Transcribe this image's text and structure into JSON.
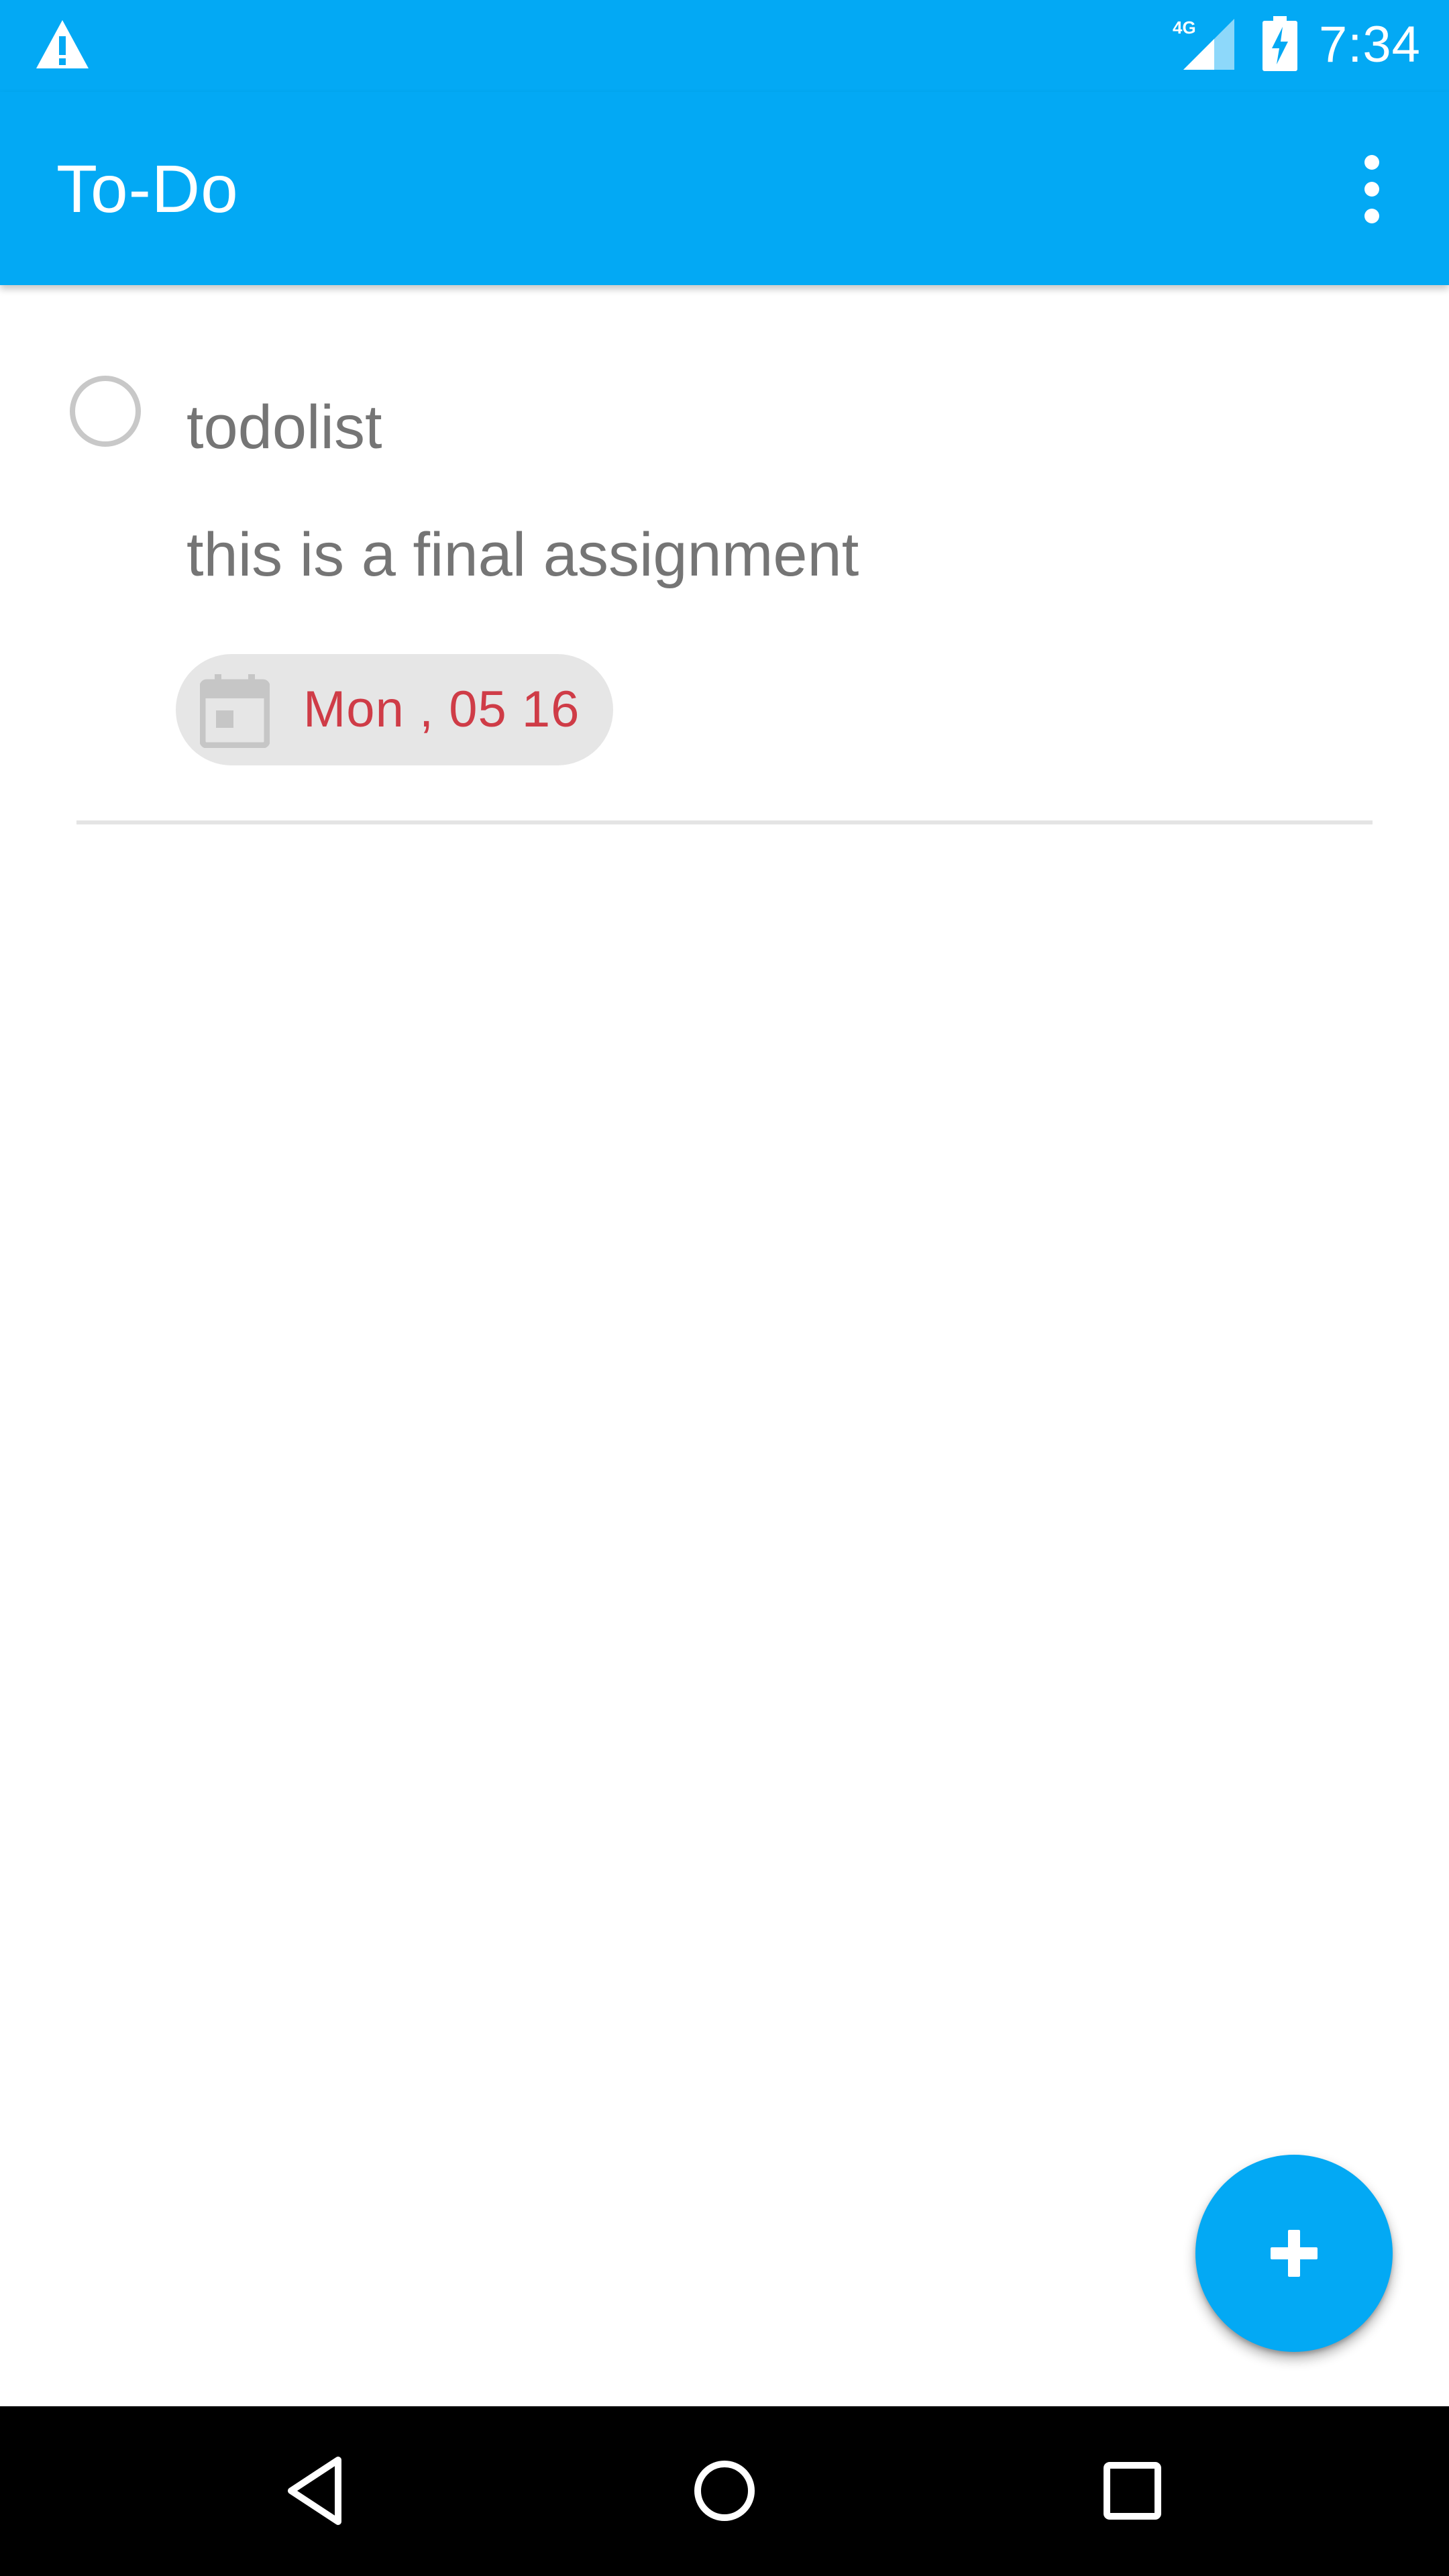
{
  "status_bar": {
    "time": "7:34",
    "network_label": "4G",
    "icons": [
      "warning-icon",
      "signal-icon",
      "battery-charging-icon"
    ]
  },
  "app_bar": {
    "title": "To-Do",
    "overflow_icon": "more-vert-icon"
  },
  "todo_items": [
    {
      "title": "todolist",
      "description": "this is a final assignment",
      "due_date": "Mon , 05 16",
      "completed": false,
      "date_icon": "calendar-icon"
    }
  ],
  "fab": {
    "icon": "plus-icon"
  },
  "nav_bar": {
    "icons": [
      "back-icon",
      "home-icon",
      "recents-icon"
    ]
  },
  "colors": {
    "primary": "#03A9F4",
    "due_date_text": "#cf3c47",
    "body_text": "#757575",
    "chip_background": "#e6e6e6"
  }
}
